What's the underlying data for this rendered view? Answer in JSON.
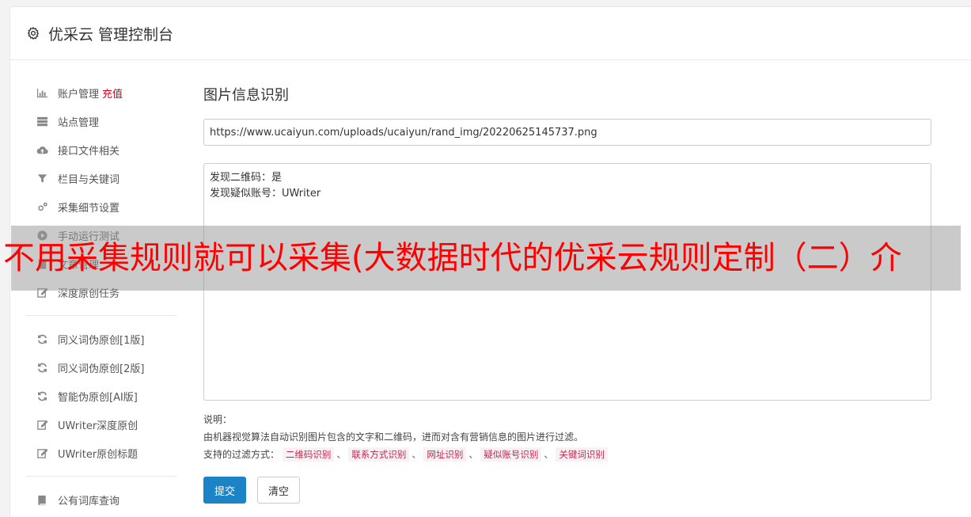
{
  "header": {
    "title": "优采云 管理控制台",
    "icon": "gear-icon"
  },
  "sidebar": {
    "group1": [
      {
        "label": "账户管理",
        "badge": "充值",
        "icon": "bar-chart-icon"
      },
      {
        "label": "站点管理",
        "icon": "server-icon"
      },
      {
        "label": "接口文件相关",
        "icon": "cloud-upload-icon"
      },
      {
        "label": "栏目与关键词",
        "icon": "filter-icon"
      },
      {
        "label": "采集细节设置",
        "icon": "cogs-icon"
      },
      {
        "label": "手动运行测试",
        "icon": "play-circle-icon"
      },
      {
        "label": "文章管理",
        "icon": "file-icon"
      },
      {
        "label": "深度原创任务",
        "icon": "edit-icon"
      }
    ],
    "group2": [
      {
        "label": "同义词伪原创[1版]",
        "icon": "refresh-icon"
      },
      {
        "label": "同义词伪原创[2版]",
        "icon": "refresh-icon"
      },
      {
        "label": "智能伪原创[AI版]",
        "icon": "refresh-icon"
      },
      {
        "label": "UWriter深度原创",
        "icon": "edit-icon"
      },
      {
        "label": "UWriter原创标题",
        "icon": "edit-icon"
      }
    ],
    "group3": [
      {
        "label": "公有词库查询",
        "icon": "book-icon"
      }
    ]
  },
  "main": {
    "title": "图片信息识别",
    "url_value": "https://www.ucaiyun.com/uploads/ucaiyun/rand_img/20220625145737.png",
    "result_line1": "发现二维码：是",
    "result_line2": "发现疑似账号：UWriter",
    "notes_label": "说明：",
    "notes_desc": "由机器视觉算法自动识别图片包含的文字和二维码，进而对含有营销信息的图片进行过滤。",
    "filter_label": "支持的过滤方式：",
    "filter_tags": [
      "二维码识别",
      "联系方式识别",
      "网址识别",
      "疑似账号识别",
      "关键词识别"
    ],
    "tag_separator": "、",
    "submit_label": "提交",
    "clear_label": "清空"
  },
  "overlay": {
    "text": "不用采集规则就可以采集(大数据时代的优采云规则定制（二）介"
  },
  "colors": {
    "primary": "#1c84c6",
    "overlay_text": "#ff0000",
    "recharge": "#d9001b",
    "tag_text": "#c7254e",
    "tag_bg": "#f9f2f4"
  }
}
